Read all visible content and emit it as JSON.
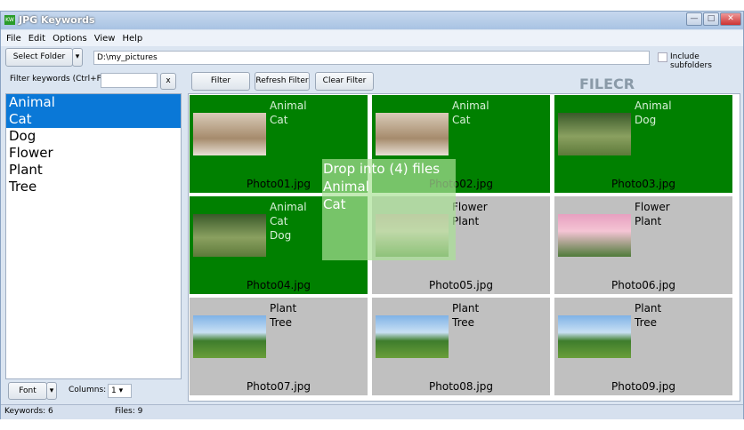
{
  "window": {
    "title": "JPG Keywords",
    "icon": "KW",
    "min": "—",
    "max": "□",
    "close": "✕"
  },
  "menu": [
    "File",
    "Edit",
    "Options",
    "View",
    "Help"
  ],
  "toolbar": {
    "select_folder": "Select Folder",
    "dropdown": "▾",
    "path": "D:\\my_pictures",
    "include_subfolders": "Include subfolders"
  },
  "filter": {
    "label": "Filter keywords (Ctrl+F)",
    "value": "",
    "clear": "x",
    "filter": "Filter",
    "refresh": "Refresh Filter",
    "clear_filter": "Clear Filter"
  },
  "keywords": [
    {
      "label": "Animal",
      "selected": true
    },
    {
      "label": "Cat",
      "selected": true
    },
    {
      "label": "Dog",
      "selected": false
    },
    {
      "label": "Flower",
      "selected": false
    },
    {
      "label": "Plant",
      "selected": false
    },
    {
      "label": "Tree",
      "selected": false
    }
  ],
  "files": [
    {
      "name": "Photo01.jpg",
      "keywords": [
        "Animal",
        "Cat"
      ],
      "status": "green",
      "thumb": "cat"
    },
    {
      "name": "Photo02.jpg",
      "keywords": [
        "Animal",
        "Cat"
      ],
      "status": "green",
      "thumb": "cat"
    },
    {
      "name": "Photo03.jpg",
      "keywords": [
        "Animal",
        "Dog"
      ],
      "status": "green",
      "thumb": "dog"
    },
    {
      "name": "Photo04.jpg",
      "keywords": [
        "Animal",
        "Cat",
        "Dog"
      ],
      "status": "green",
      "thumb": "dog"
    },
    {
      "name": "Photo05.jpg",
      "keywords": [
        "Flower",
        "Plant"
      ],
      "status": "grey",
      "thumb": "flower"
    },
    {
      "name": "Photo06.jpg",
      "keywords": [
        "Flower",
        "Plant"
      ],
      "status": "grey",
      "thumb": "flower"
    },
    {
      "name": "Photo07.jpg",
      "keywords": [
        "Plant",
        "Tree"
      ],
      "status": "grey",
      "thumb": "tree"
    },
    {
      "name": "Photo08.jpg",
      "keywords": [
        "Plant",
        "Tree"
      ],
      "status": "grey",
      "thumb": "tree"
    },
    {
      "name": "Photo09.jpg",
      "keywords": [
        "Plant",
        "Tree"
      ],
      "status": "grey",
      "thumb": "tree"
    }
  ],
  "drag_overlay": {
    "lines": [
      "Drop into (4) files",
      "Animal",
      "Cat"
    ]
  },
  "bottom": {
    "font": "Font",
    "columns_label": "Columns:",
    "columns_value": "1"
  },
  "status": {
    "keywords": "Keywords: 6",
    "files": "Files: 9"
  },
  "watermark": "FILECR"
}
